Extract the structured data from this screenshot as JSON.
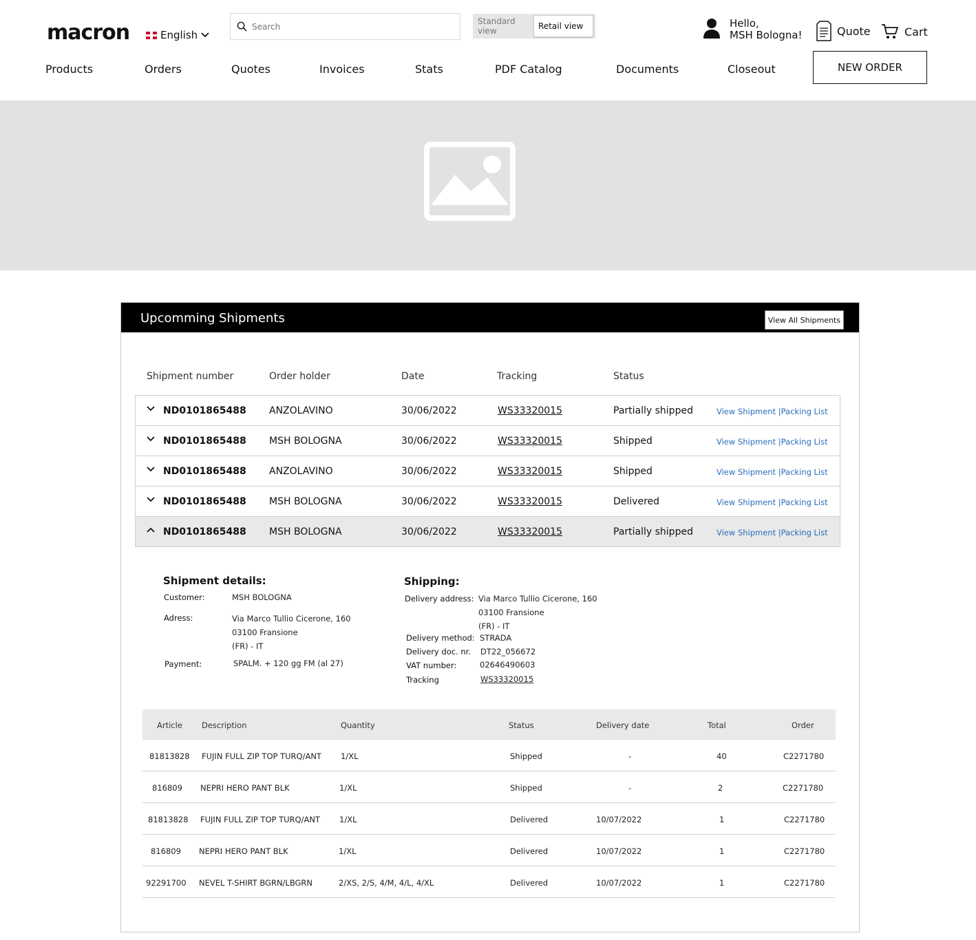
{
  "header": {
    "logo": "macron",
    "language": "English",
    "search_placeholder": "Search",
    "view_standard": "Standard view",
    "view_retail": "Retail view",
    "greeting_line1": "Hello,",
    "greeting_line2": "MSH Bologna!",
    "quote_label": "Quote",
    "cart_label": "Cart"
  },
  "nav": {
    "items": [
      "Products",
      "Orders",
      "Quotes",
      "Invoices",
      "Stats",
      "PDF Catalog",
      "Documents",
      "Closeout"
    ],
    "new_order": "NEW ORDER"
  },
  "shipments": {
    "title": "Upcomming Shipments",
    "view_all": "View All Shipments",
    "columns": [
      "Shipment number",
      "Order holder",
      "Date",
      "Tracking",
      "Status"
    ],
    "rows": [
      {
        "number": "ND0101865488",
        "holder": "ANZOLAVINO",
        "date": "30/06/2022",
        "tracking": "WS33320015",
        "status": "Partially shipped",
        "links": "View Shipment |Packing List"
      },
      {
        "number": "ND0101865488",
        "holder": "MSH BOLOGNA",
        "date": "30/06/2022",
        "tracking": "WS33320015",
        "status": "Shipped",
        "links": "View Shipment |Packing List"
      },
      {
        "number": "ND0101865488",
        "holder": "ANZOLAVINO",
        "date": "30/06/2022",
        "tracking": "WS33320015",
        "status": "Shipped",
        "links": "View Shipment |Packing List"
      },
      {
        "number": "ND0101865488",
        "holder": "MSH BOLOGNA",
        "date": "30/06/2022",
        "tracking": "WS33320015",
        "status": "Delivered",
        "links": "View Shipment |Packing List"
      },
      {
        "number": "ND0101865488",
        "holder": "MSH BOLOGNA",
        "date": "30/06/2022",
        "tracking": "WS33320015",
        "status": "Partially shipped",
        "links": "View Shipment |Packing List"
      }
    ]
  },
  "details": {
    "title": "Shipment details:",
    "customer_label": "Customer:",
    "customer": "MSH BOLOGNA",
    "address_label": "Adress:",
    "address_1": "Via Marco Tullio Cicerone, 160",
    "address_2": "03100 Fransione",
    "address_3": "(FR) - IT",
    "payment_label": "Payment:",
    "payment": "SPALM. + 120 gg FM (al 27)"
  },
  "shipping": {
    "title": "Shipping:",
    "delivery_address_label": "Delivery address:",
    "delivery_address_1": "Via Marco Tullio Cicerone, 160",
    "delivery_address_2": "03100 Fransione",
    "delivery_address_3": "(FR) - IT",
    "method_label": "Delivery method:",
    "method": "STRADA",
    "doc_label": "Delivery doc. nr.",
    "doc": "DT22_056672",
    "vat_label": "VAT number:",
    "vat": "02646490603",
    "tracking_label": "Tracking",
    "tracking": "WS33320015"
  },
  "items": {
    "columns": [
      "Article",
      "Description",
      "Quantity",
      "Status",
      "Delivery date",
      "Total",
      "Order"
    ],
    "rows": [
      {
        "article": "81813828",
        "description": "FUJIN FULL ZIP TOP TURQ/ANT",
        "quantity": "1/XL",
        "status": "Shipped",
        "delivery": "-",
        "total": "40",
        "order": "C2271780"
      },
      {
        "article": "816809",
        "description": "NEPRI HERO PANT BLK",
        "quantity": "1/XL",
        "status": "Shipped",
        "delivery": "-",
        "total": "2",
        "order": "C2271780"
      },
      {
        "article": "81813828",
        "description": "FUJIN FULL ZIP TOP TURQ/ANT",
        "quantity": "1/XL",
        "status": "Delivered",
        "delivery": "10/07/2022",
        "total": "1",
        "order": "C2271780"
      },
      {
        "article": "816809",
        "description": "NEPRI HERO PANT BLK",
        "quantity": "1/XL",
        "status": "Delivered",
        "delivery": "10/07/2022",
        "total": "1",
        "order": "C2271780"
      },
      {
        "article": "92291700",
        "description": "NEVEL T-SHIRT BGRN/LBGRN",
        "quantity": "2/XS, 2/S, 4/M, 4/L, 4/XL",
        "status": "Delivered",
        "delivery": "10/07/2022",
        "total": "1",
        "order": "C2271780"
      }
    ]
  },
  "colors": {
    "link": "#2a6ebb",
    "banner": "#e2e2e2",
    "header_bar": "#000000"
  }
}
